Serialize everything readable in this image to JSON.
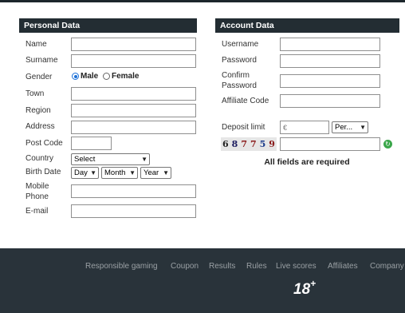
{
  "personal": {
    "header": "Personal Data",
    "name_label": "Name",
    "surname_label": "Surname",
    "gender_label": "Gender",
    "gender_male": "Male",
    "gender_female": "Female",
    "gender_selected": "Male",
    "town_label": "Town",
    "region_label": "Region",
    "address_label": "Address",
    "postcode_label": "Post Code",
    "country_label": "Country",
    "country_value": "Select",
    "birthdate_label": "Birth Date",
    "day_value": "Day",
    "month_value": "Month",
    "year_value": "Year",
    "mobile_label_1": "Mobile",
    "mobile_label_2": "Phone",
    "email_label": "E-mail"
  },
  "account": {
    "header": "Account Data",
    "username_label": "Username",
    "password_label": "Password",
    "confirm_label_1": "Confirm",
    "confirm_label_2": "Password",
    "affiliate_label": "Affiliate Code",
    "deposit_label": "Deposit limit",
    "deposit_placeholder": "€",
    "period_value": "Per...",
    "captcha_digits": [
      "6",
      "8",
      "7",
      "7",
      "5",
      "9"
    ],
    "captcha_colors": [
      "#222222",
      "#1a1a5e",
      "#8a1a1a",
      "#8a1a1a",
      "#1a3a8a",
      "#8a1a1a"
    ],
    "required_note": "All fields are required"
  },
  "footer": {
    "links": [
      "Responsible gaming",
      "Coupon",
      "Results",
      "Rules",
      "Live scores",
      "Affiliates",
      "Company"
    ],
    "age_number": "18",
    "age_plus": "+"
  }
}
